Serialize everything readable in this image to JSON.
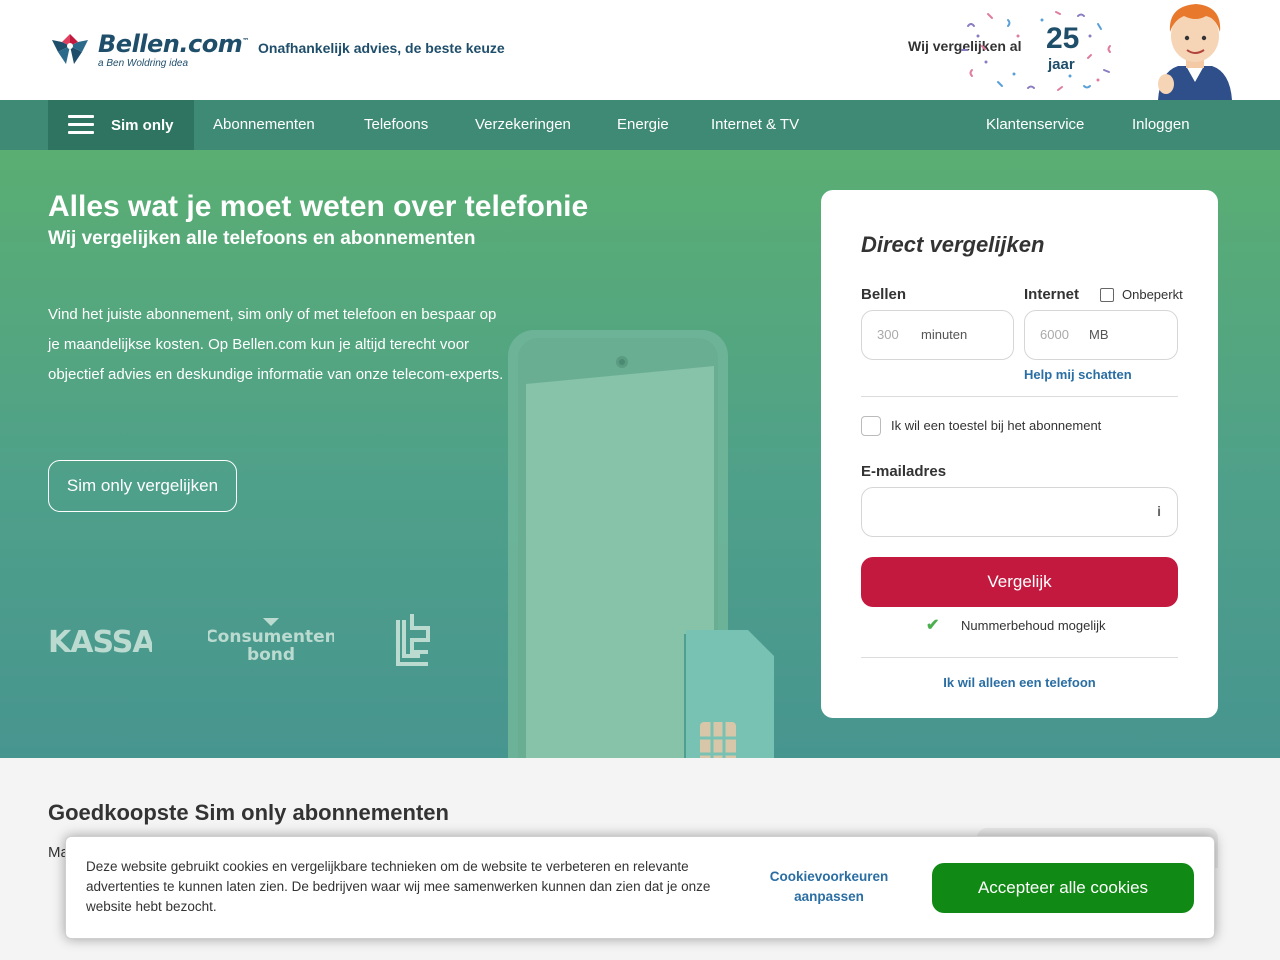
{
  "header": {
    "logo_name": "Bellen.com",
    "logo_trademark": "™",
    "logo_sub": "a Ben Woldring idea",
    "tagline": "Onafhankelijk advies, de beste keuze",
    "anniversary_label": "Wij vergelijken al",
    "anniversary_number": "25",
    "anniversary_unit": "jaar"
  },
  "nav": {
    "menu_label": "Sim only",
    "items": [
      "Abonnementen",
      "Telefoons",
      "Verzekeringen",
      "Energie",
      "Internet & TV"
    ],
    "right_items": [
      "Klantenservice",
      "Inloggen"
    ]
  },
  "hero": {
    "title": "Alles wat je moet weten over telefonie",
    "subtitle": "Wij vergelijken alle telefoons en abonnementen",
    "text": "Vind het juiste abonnement, sim only of met telefoon en bespaar op je maandelijkse kosten. Op Bellen.com kun je altijd terecht voor objectief advies en deskundige informatie van onze telecom-experts.",
    "cta": "Sim only vergelijken",
    "brands": {
      "kassa": "KASSA",
      "consumentenbond_line1": "Consumenten",
      "consumentenbond_line2": "bond"
    }
  },
  "form": {
    "title": "Direct vergelijken",
    "calls_label": "Bellen",
    "calls_placeholder": "300",
    "calls_unit": "minuten",
    "internet_label": "Internet",
    "unlimited_label": "Onbeperkt",
    "internet_placeholder": "6000",
    "internet_unit": "MB",
    "help_link": "Help mij schatten",
    "device_checkbox_label": "Ik wil een toestel bij het abonnement",
    "email_label": "E-mailadres",
    "email_info_icon": "i",
    "submit": "Vergelijk",
    "number_keep_icon": "✔",
    "number_keep": "Nummerbehoud mogelijk",
    "phone_only_link": "Ik wil alleen een telefoon"
  },
  "section": {
    "title": "Goedkoopste Sim only abonnementen",
    "fragment": "Ma"
  },
  "cookie": {
    "text": "Deze website gebruikt cookies en vergelijkbare technieken om de website te verbeteren en relevante advertenties te kunnen laten zien. De bedrijven waar wij mee samenwerken kunnen dan zien dat je onze website hebt bezocht.",
    "prefs": "Cookievoorkeuren aanpassen",
    "accept": "Accepteer alle cookies"
  },
  "colors": {
    "brand_navy": "#1f4e6b",
    "nav_green": "#3f8a74",
    "submit_red": "#c3193f",
    "accept_green": "#108a14",
    "link_blue": "#2a6ea3"
  },
  "icons": [
    "logo-flower-icon",
    "hamburger-icon",
    "checkmark-icon",
    "info-icon",
    "phone-illustration",
    "sim-card-illustration"
  ]
}
